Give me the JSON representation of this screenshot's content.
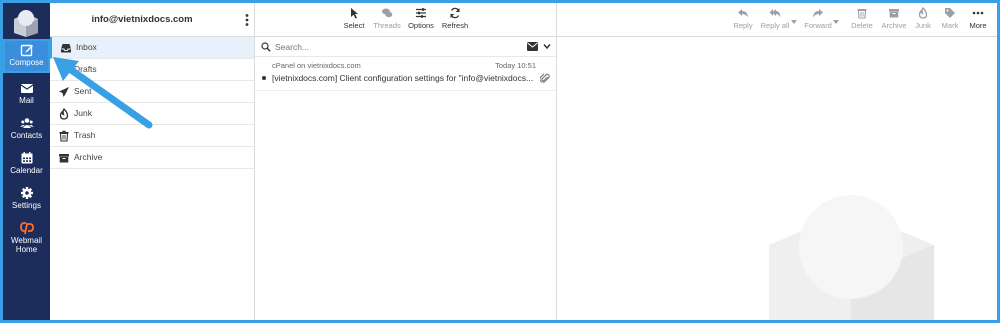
{
  "colors": {
    "nav_bg": "#1c2d5c",
    "accent": "#3aa0e6",
    "compose_bg": "#3b8edb",
    "active_folder_bg": "#e6f1fb"
  },
  "nav": {
    "items": [
      {
        "label": "Compose",
        "icon": "compose-icon"
      },
      {
        "label": "Mail",
        "icon": "envelope-icon"
      },
      {
        "label": "Contacts",
        "icon": "users-icon"
      },
      {
        "label": "Calendar",
        "icon": "calendar-icon"
      },
      {
        "label": "Settings",
        "icon": "gear-icon"
      },
      {
        "label": "Webmail Home",
        "icon": "cpanel-icon"
      }
    ]
  },
  "account": {
    "email": "info@vietnixdocs.com"
  },
  "folders": [
    {
      "label": "Inbox",
      "icon": "inbox-icon",
      "active": true
    },
    {
      "label": "Drafts",
      "icon": "pencil-icon"
    },
    {
      "label": "Sent",
      "icon": "paper-plane-icon"
    },
    {
      "label": "Junk",
      "icon": "fire-icon"
    },
    {
      "label": "Trash",
      "icon": "trash-icon"
    },
    {
      "label": "Archive",
      "icon": "archive-icon"
    }
  ],
  "list_toolbar": {
    "select": "Select",
    "threads": "Threads",
    "options": "Options",
    "refresh": "Refresh"
  },
  "search": {
    "placeholder": "Search..."
  },
  "message": {
    "from": "cPanel on vietnixdocs.com",
    "date": "Today 10:51",
    "subject": "[vietnixdocs.com] Client configuration settings for \"info@vietnixdocs....",
    "has_attachment": true
  },
  "preview_toolbar": {
    "reply": "Reply",
    "reply_all": "Reply all",
    "forward": "Forward",
    "delete": "Delete",
    "archive": "Archive",
    "junk": "Junk",
    "mark": "Mark",
    "more": "More"
  }
}
